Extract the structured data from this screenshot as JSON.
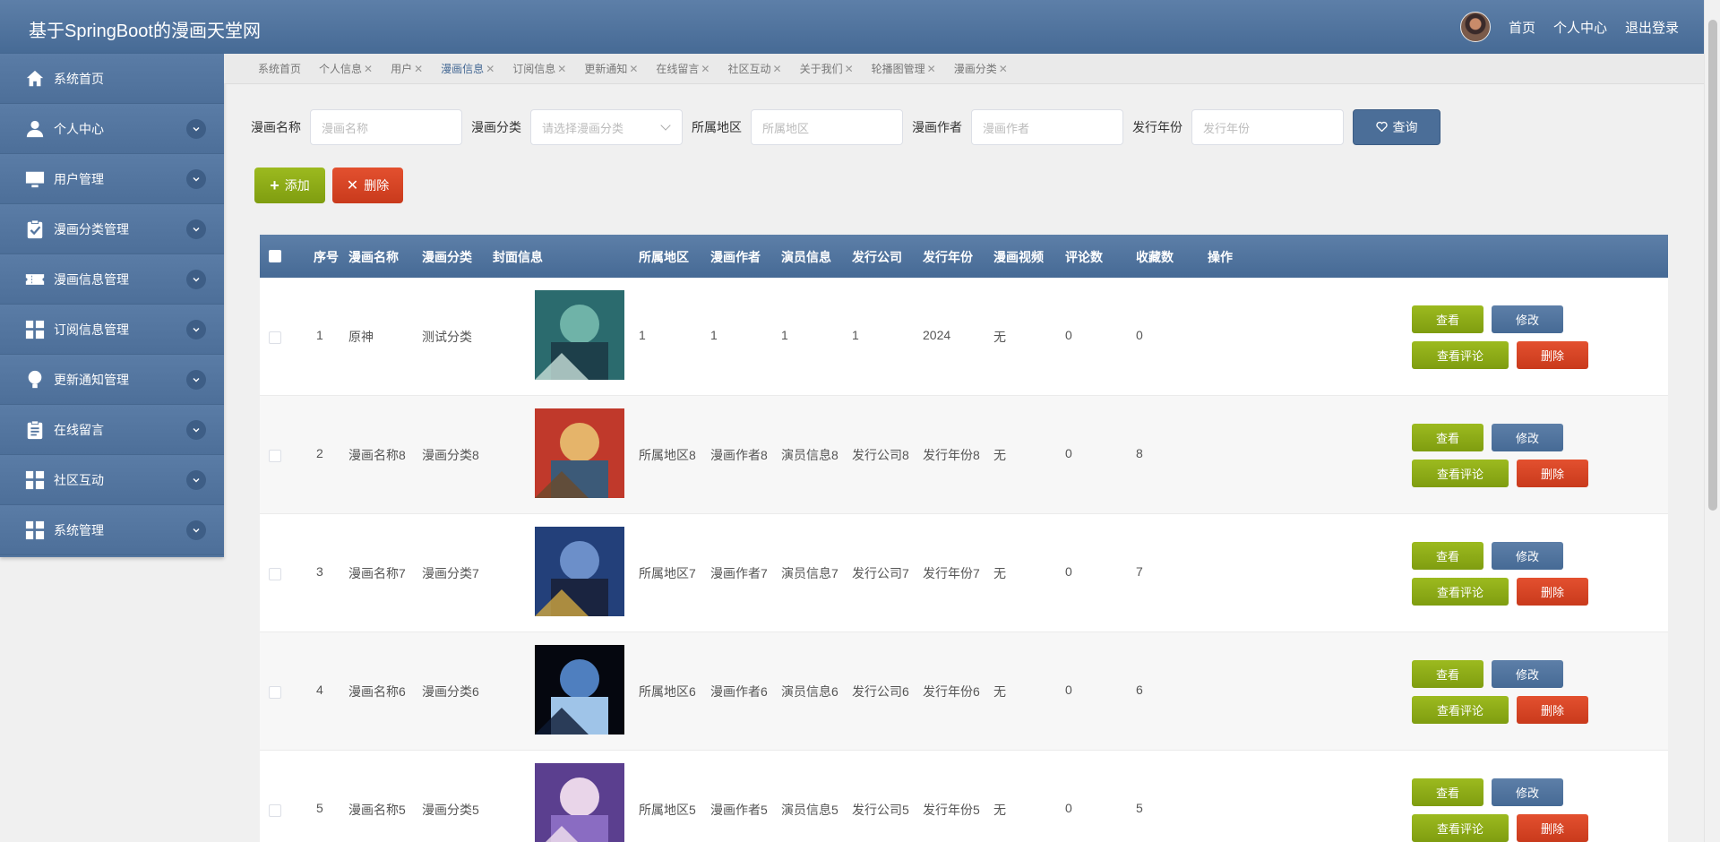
{
  "header": {
    "title": "基于SpringBoot的漫画天堂网",
    "links": [
      "首页",
      "个人中心",
      "退出登录"
    ]
  },
  "sidebar": {
    "items": [
      {
        "label": "系统首页",
        "icon": "home-icon",
        "expandable": false
      },
      {
        "label": "个人中心",
        "icon": "user-icon",
        "expandable": true
      },
      {
        "label": "用户管理",
        "icon": "monitor-icon",
        "expandable": true
      },
      {
        "label": "漫画分类管理",
        "icon": "clipboard-check-icon",
        "expandable": true
      },
      {
        "label": "漫画信息管理",
        "icon": "ticket-icon",
        "expandable": true
      },
      {
        "label": "订阅信息管理",
        "icon": "grid-icon",
        "expandable": true
      },
      {
        "label": "更新通知管理",
        "icon": "bulb-icon",
        "expandable": true
      },
      {
        "label": "在线留言",
        "icon": "clipboard-icon",
        "expandable": true
      },
      {
        "label": "社区互动",
        "icon": "grid-icon",
        "expandable": true
      },
      {
        "label": "系统管理",
        "icon": "grid-icon",
        "expandable": true
      }
    ]
  },
  "tabs": [
    {
      "label": "系统首页",
      "closable": false,
      "active": false
    },
    {
      "label": "个人信息",
      "closable": true,
      "active": false
    },
    {
      "label": "用户",
      "closable": true,
      "active": false
    },
    {
      "label": "漫画信息",
      "closable": true,
      "active": true
    },
    {
      "label": "订阅信息",
      "closable": true,
      "active": false
    },
    {
      "label": "更新通知",
      "closable": true,
      "active": false
    },
    {
      "label": "在线留言",
      "closable": true,
      "active": false
    },
    {
      "label": "社区互动",
      "closable": true,
      "active": false
    },
    {
      "label": "关于我们",
      "closable": true,
      "active": false
    },
    {
      "label": "轮播图管理",
      "closable": true,
      "active": false
    },
    {
      "label": "漫画分类",
      "closable": true,
      "active": false
    }
  ],
  "search": {
    "fields": [
      {
        "label": "漫画名称",
        "placeholder": "漫画名称",
        "type": "text"
      },
      {
        "label": "漫画分类",
        "placeholder": "请选择漫画分类",
        "type": "select"
      },
      {
        "label": "所属地区",
        "placeholder": "所属地区",
        "type": "text"
      },
      {
        "label": "漫画作者",
        "placeholder": "漫画作者",
        "type": "text"
      },
      {
        "label": "发行年份",
        "placeholder": "发行年份",
        "type": "text"
      }
    ],
    "query_label": "查询"
  },
  "actions": {
    "add_label": "添加",
    "delete_label": "删除"
  },
  "table": {
    "columns": [
      "序号",
      "漫画名称",
      "漫画分类",
      "封面信息",
      "所属地区",
      "漫画作者",
      "演员信息",
      "发行公司",
      "发行年份",
      "漫画视频",
      "评论数",
      "收藏数",
      "操作"
    ],
    "rows": [
      {
        "index": "1",
        "name": "原神",
        "category": "测试分类",
        "region": "1",
        "author": "1",
        "actors": "1",
        "publisher": "1",
        "year": "2024",
        "video": "无",
        "comments": "0",
        "favorites": "0",
        "cover_colors": [
          "#2b6b6e",
          "#6fb3a8",
          "#1d3f4a",
          "#c8e0d8"
        ]
      },
      {
        "index": "2",
        "name": "漫画名称8",
        "category": "漫画分类8",
        "region": "所属地区8",
        "author": "漫画作者8",
        "actors": "演员信息8",
        "publisher": "发行公司8",
        "year": "发行年份8",
        "video": "无",
        "comments": "0",
        "favorites": "8",
        "cover_colors": [
          "#c0392b",
          "#e5b46a",
          "#3c5a78",
          "#6a4a2a"
        ]
      },
      {
        "index": "3",
        "name": "漫画名称7",
        "category": "漫画分类7",
        "region": "所属地区7",
        "author": "漫画作者7",
        "actors": "演员信息7",
        "publisher": "发行公司7",
        "year": "发行年份7",
        "video": "无",
        "comments": "0",
        "favorites": "7",
        "cover_colors": [
          "#23407a",
          "#6c8fc9",
          "#1a2440",
          "#d0a640"
        ]
      },
      {
        "index": "4",
        "name": "漫画名称6",
        "category": "漫画分类6",
        "region": "所属地区6",
        "author": "漫画作者6",
        "actors": "演员信息6",
        "publisher": "发行公司6",
        "year": "发行年份6",
        "video": "无",
        "comments": "0",
        "favorites": "6",
        "cover_colors": [
          "#05070f",
          "#4f7fbf",
          "#9fc4e8",
          "#0d1a33"
        ]
      },
      {
        "index": "5",
        "name": "漫画名称5",
        "category": "漫画分类5",
        "region": "所属地区5",
        "author": "漫画作者5",
        "actors": "演员信息5",
        "publisher": "发行公司5",
        "year": "发行年份5",
        "video": "无",
        "comments": "0",
        "favorites": "5",
        "cover_colors": [
          "#5b3f8f",
          "#e9d5e9",
          "#8a6cc2",
          "#f2e4ef"
        ]
      }
    ],
    "row_actions": {
      "view": "查看",
      "edit": "修改",
      "comments": "查看评论",
      "delete": "删除"
    }
  },
  "colors": {
    "primary": "#4b6e98",
    "success": "#8aaa16",
    "danger": "#d8442a"
  }
}
